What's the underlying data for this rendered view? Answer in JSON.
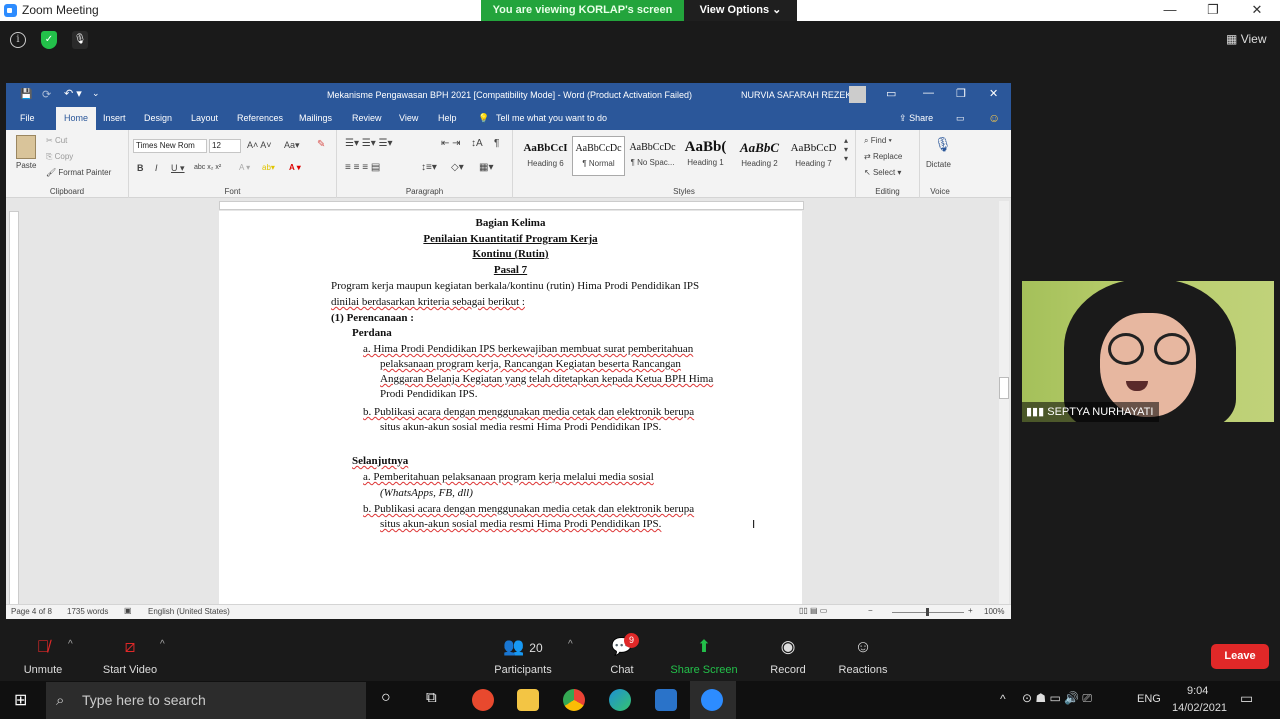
{
  "zoom": {
    "window_title": "Zoom Meeting",
    "share_banner": "You are viewing KORLAP's screen",
    "view_options": "View Options",
    "view_label": "View",
    "minimize": "—",
    "restore": "❐",
    "close": "✕"
  },
  "word": {
    "title": "Mekanisme Pengawasan BPH 2021 [Compatibility Mode]  -  Word (Product Activation Failed)",
    "user": "NURVIA SAFARAH REZEKI",
    "tabs": [
      "File",
      "Home",
      "Insert",
      "Design",
      "Layout",
      "References",
      "Mailings",
      "Review",
      "View",
      "Help"
    ],
    "tell_me": "Tell me what you want to do",
    "share": "Share",
    "clipboard": {
      "paste": "Paste",
      "cut": "Cut",
      "copy": "Copy",
      "format_painter": "Format Painter",
      "label": "Clipboard"
    },
    "font": {
      "name": "Times New Rom",
      "size": "12",
      "label": "Font"
    },
    "paragraph_label": "Paragraph",
    "styles": [
      {
        "sample": "AaBbCcI",
        "name": "Heading 6"
      },
      {
        "sample": "AaBbCcDc",
        "name": "¶ Normal"
      },
      {
        "sample": "AaBbCcDc",
        "name": "¶ No Spac..."
      },
      {
        "sample": "AaBb(",
        "name": "Heading 1"
      },
      {
        "sample": "AaBbC",
        "name": "Heading 2"
      },
      {
        "sample": "AaBbCcD",
        "name": "Heading 7"
      }
    ],
    "styles_label": "Styles",
    "editing": {
      "find": "Find",
      "replace": "Replace",
      "select": "Select",
      "label": "Editing"
    },
    "voice": {
      "dictate": "Dictate",
      "label": "Voice"
    },
    "status": {
      "page": "Page 4 of 8",
      "words": "1735 words",
      "language": "English (United States)",
      "zoom": "100%"
    }
  },
  "document": {
    "l1": "Bagian Kelima",
    "l2": "Penilaian Kuantitatif Program Kerja",
    "l3": "Kontinu (Rutin)",
    "l4": "Pasal 7",
    "p1a": "Program kerja maupun kegiatan berkala/kontinu (rutin) Hima Prodi Pendidikan IPS",
    "p1b": "dinilai berdasarkan kriteria sebagai berikut :",
    "item1": "(1)   Perencanaan :",
    "perdana": "Perdana",
    "a1_1": "a.   Hima Prodi Pendidikan IPS berkewajiban membuat surat pemberitahuan",
    "a1_2": "pelaksanaan   program   kerja,   Rancangan   Kegiatan   beserta   Rancangan",
    "a1_3": "Anggaran Belanja Kegiatan yang telah ditetapkan kepada Ketua BPH Hima",
    "a1_4": "Prodi Pendidikan IPS.",
    "b1_1": "b.   Publikasi acara dengan menggunakan media cetak dan elektronik berupa",
    "b1_2": "situs akun-akun sosial media resmi Hima Prodi Pendidikan IPS.",
    "selanjutnya": "Selanjutnya",
    "a2_1": "a.   Pemberitahuan pelaksanaan program kerja melalui media sosial",
    "a2_2": "(WhatsApps, FB, dll)",
    "b2_1": "b.   Publikasi acara dengan menggunakan media cetak dan elektronik berupa",
    "b2_2": "situs   akun-akun   sosial   media   resmi   Hima   Prodi   Pendidikan   IPS."
  },
  "video": {
    "name": "SEPTYA NURHAYATI"
  },
  "toolbar": {
    "unmute": "Unmute",
    "start_video": "Start Video",
    "participants": "Participants",
    "participants_count": "20",
    "chat": "Chat",
    "chat_badge": "9",
    "share_screen": "Share Screen",
    "record": "Record",
    "reactions": "Reactions",
    "leave": "Leave"
  },
  "taskbar": {
    "search_placeholder": "Type here to search",
    "lang": "ENG",
    "time": "9:04",
    "date": "14/02/2021"
  }
}
